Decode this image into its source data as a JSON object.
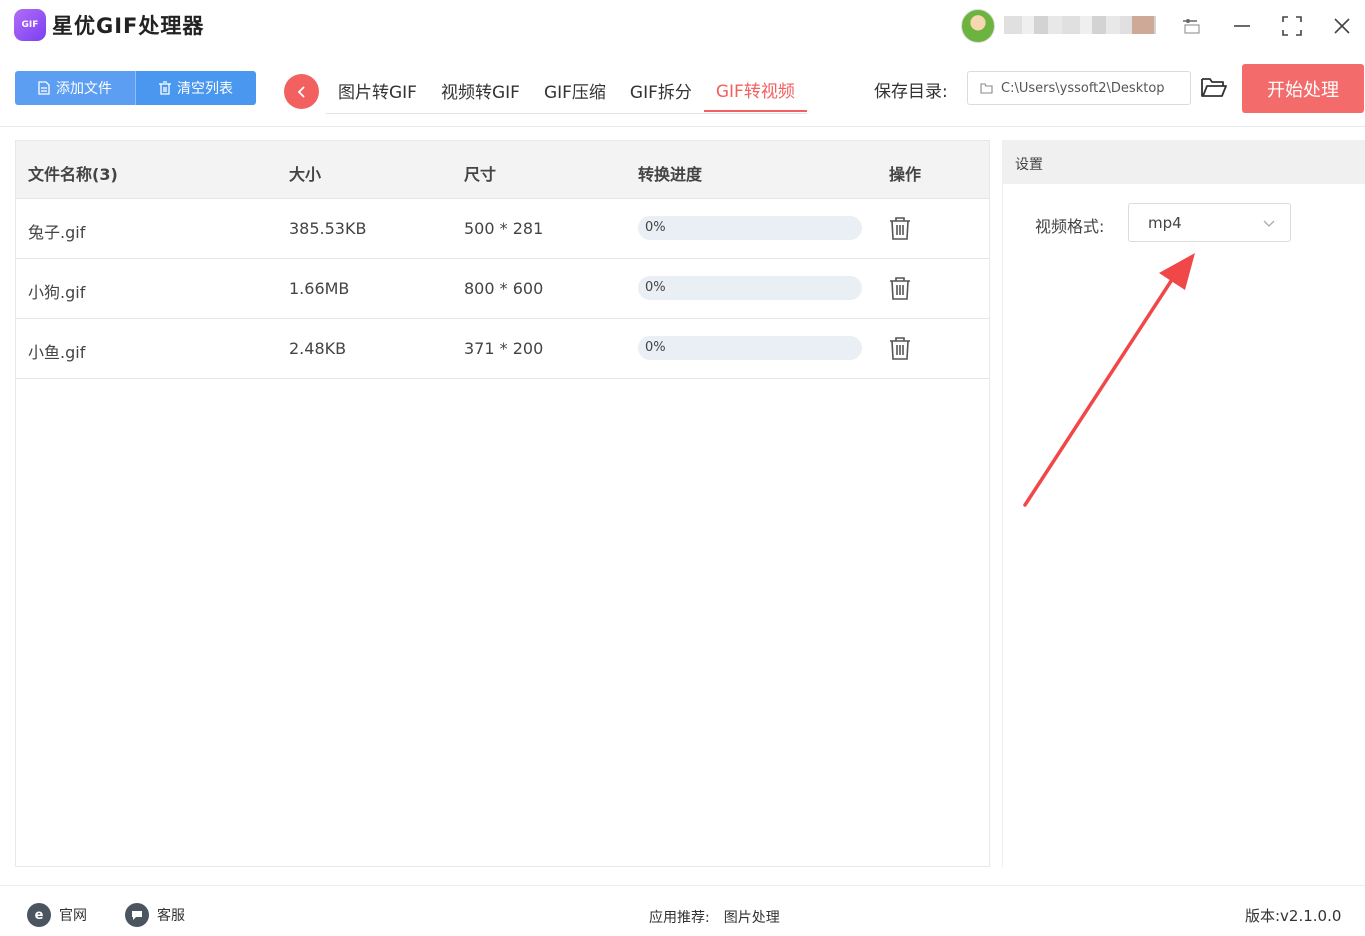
{
  "app": {
    "title": "星优GIF处理器",
    "logo_text": "GIF"
  },
  "toolbar": {
    "add_file": "添加文件",
    "clear_list": "清空列表",
    "back_icon": "chevron-left-icon"
  },
  "tabs": [
    {
      "label": "图片转GIF",
      "active": false
    },
    {
      "label": "视频转GIF",
      "active": false
    },
    {
      "label": "GIF压缩",
      "active": false
    },
    {
      "label": "GIF拆分",
      "active": false
    },
    {
      "label": "GIF转视频",
      "active": true
    }
  ],
  "save": {
    "label": "保存目录:",
    "path": "C:\\Users\\yssoft2\\Desktop"
  },
  "start_button": "开始处理",
  "table": {
    "headers": {
      "name": "文件名称(3)",
      "size": "大小",
      "dimensions": "尺寸",
      "progress": "转换进度",
      "action": "操作"
    },
    "rows": [
      {
        "name": "兔子.gif",
        "size": "385.53KB",
        "dimensions": "500 * 281",
        "progress_text": "0%",
        "progress": 0
      },
      {
        "name": "小狗.gif",
        "size": "1.66MB",
        "dimensions": "800 * 600",
        "progress_text": "0%",
        "progress": 0
      },
      {
        "name": "小鱼.gif",
        "size": "2.48KB",
        "dimensions": "371 * 200",
        "progress_text": "0%",
        "progress": 0
      }
    ]
  },
  "settings": {
    "title": "设置",
    "format_label": "视频格式:",
    "format_value": "mp4"
  },
  "footer": {
    "website": "官网",
    "support": "客服",
    "recommend_label": "应用推荐:",
    "recommend_value": "图片处理",
    "version": "版本:v2.1.0.0"
  },
  "colors": {
    "accent_blue": "#4a97f0",
    "accent_red": "#f26060",
    "arrow_red": "#f04848"
  }
}
